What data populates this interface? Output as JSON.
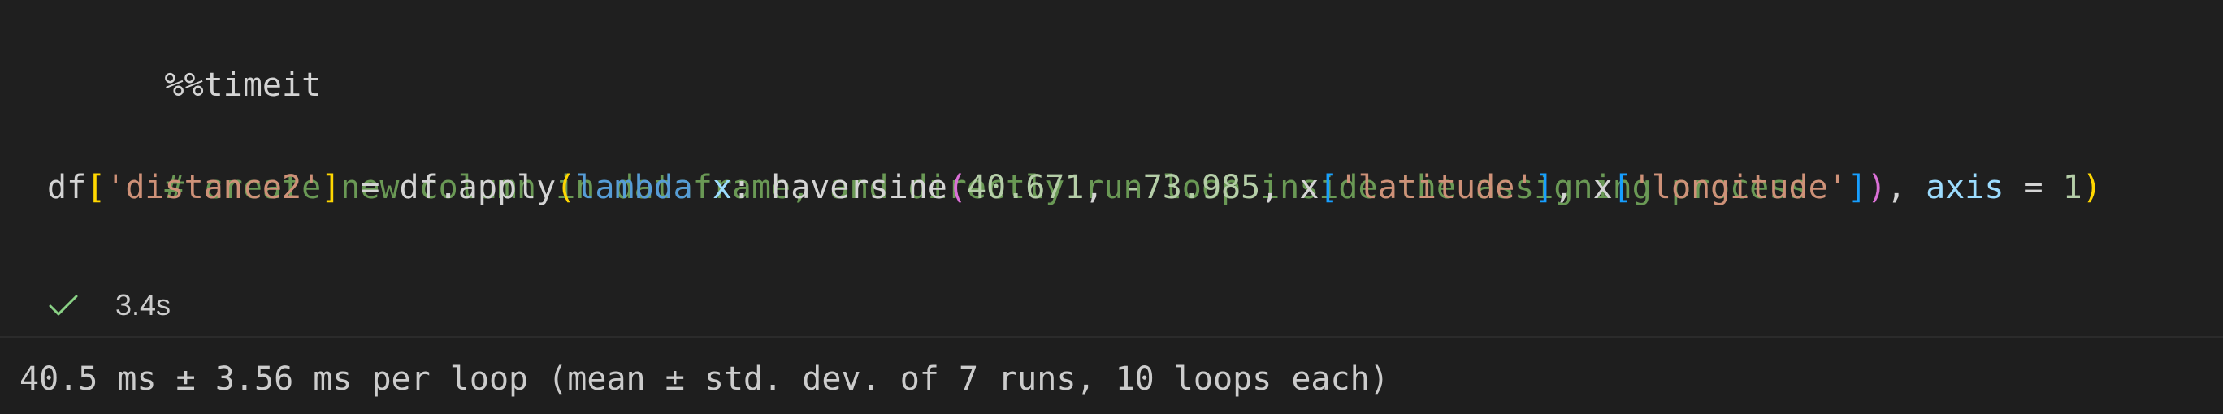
{
  "cell": {
    "magic": "%%timeit",
    "comment": "# create new column in dataframe, and directly run loop inside the assigning process",
    "code": {
      "df": "df",
      "lbr1": "[",
      "col_new": "'distance2'",
      "rbr1": "]",
      "assign": " = df.apply",
      "lp1": "(",
      "lambda_kw": "lambda",
      "sp1": " ",
      "x_param": "x",
      "colon": ": ",
      "func": "haversine",
      "lp2": "(",
      "num1": "40.671",
      "comma1": ", ",
      "num2": "-73.985",
      "comma2": ", x",
      "lbr2": "[",
      "lat": "'latitude'",
      "rbr2": "]",
      "comma3": ", x",
      "lbr3": "[",
      "lon": "'longitude'",
      "rbr3": "]",
      "rp2": ")",
      "comma4": ", ",
      "axis_kw": "axis",
      "eq": " = ",
      "num3": "1",
      "rp1": ")"
    }
  },
  "status": {
    "icon": "check-icon",
    "duration": "3.4s",
    "success_color": "#89d185"
  },
  "output": {
    "text": "40.5 ms ± 3.56 ms per loop (mean ± std. dev. of 7 runs, 10 loops each)"
  }
}
